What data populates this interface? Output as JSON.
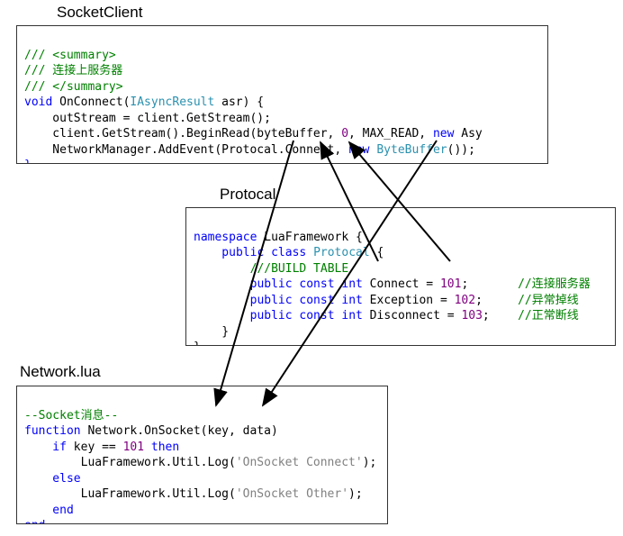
{
  "labels": {
    "socketclient": "SocketClient",
    "protocal": "Protocal",
    "networklua": "Network.lua"
  },
  "box1": {
    "l1a": "/// <summary>",
    "l2a": "/// 连接上服务器",
    "l3a": "/// </summary>",
    "l4a": "void",
    "l4b": " OnConnect(",
    "l4c": "IAsyncResult",
    "l4d": " asr) {",
    "l5": "    outStream = client.GetStream();",
    "l6a": "    client.GetStream().BeginRead(byteBuffer, ",
    "l6b": "0",
    "l6c": ", MAX_READ, ",
    "l6d": "new",
    "l6e": " Asy",
    "l7a": "    NetworkManager.AddEvent(Protocal.Connect, ",
    "l7b": "new",
    "l7c": " ",
    "l7d": "ByteBuffer",
    "l7e": "());",
    "l8": "}"
  },
  "box2": {
    "l1a": "namespace",
    "l1b": " LuaFramework {",
    "l2a": "    public",
    "l2b": " class",
    "l2c": " Protocal",
    "l2d": " {",
    "l3a": "        ///BUILD TABLE",
    "l4a": "        public",
    "l4b": " const",
    "l4c": " int",
    "l4d": " Connect = ",
    "l4e": "101",
    "l4f": ";       ",
    "l4g": "//连接服务器",
    "l5a": "        public",
    "l5b": " const",
    "l5c": " int",
    "l5d": " Exception = ",
    "l5e": "102",
    "l5f": ";     ",
    "l5g": "//异常掉线",
    "l6a": "        public",
    "l6b": " const",
    "l6c": " int",
    "l6d": " Disconnect = ",
    "l6e": "103",
    "l6f": ";    ",
    "l6g": "//正常断线",
    "l7": "    }",
    "l8": "}"
  },
  "box3": {
    "l1": "--Socket消息--",
    "l2a": "function",
    "l2b": " Network.OnSocket(key, data)",
    "l3a": "    if",
    "l3b": " key == ",
    "l3c": "101",
    "l3d": " then",
    "l4a": "        LuaFramework.Util.Log(",
    "l4b": "'OnSocket Connect'",
    "l4c": ");",
    "l5a": "    else",
    "l6a": "        LuaFramework.Util.Log(",
    "l6b": "'OnSocket Other'",
    "l6c": ");",
    "l7": "    end",
    "l8": "end"
  }
}
